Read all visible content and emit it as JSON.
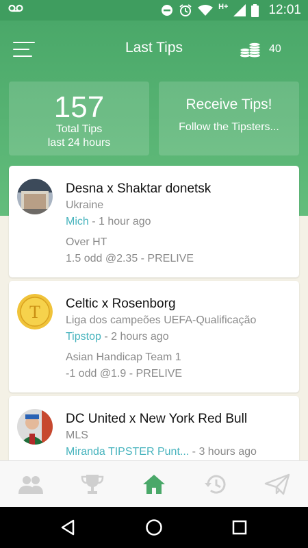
{
  "status_bar": {
    "time": "12:01",
    "network": "H+"
  },
  "header": {
    "title": "Last Tips",
    "coins": "40"
  },
  "stats": {
    "total_count": "157",
    "total_label": "Total Tips",
    "period_label": "last 24 hours",
    "receive_title": "Receive Tips!",
    "receive_subtitle": "Follow the Tipsters..."
  },
  "tips": [
    {
      "match": "Desna x Shaktar donetsk",
      "league": "Ukraine",
      "tipster": "Mich",
      "time": " - 1 hour ago",
      "bet": "Over HT",
      "odds": "1.5 odd @2.35 - PRELIVE",
      "avatar_icon": "tipster-photo"
    },
    {
      "match": "Celtic x Rosenborg",
      "league": "Liga dos campeões UEFA-Qualificação",
      "tipster": "Tipstop",
      "time": " - 2 hours ago",
      "bet": "Asian Handicap Team 1",
      "odds": "-1 odd @1.9 - PRELIVE",
      "avatar_icon": "gold-coin-t-logo"
    },
    {
      "match": "DC United x New York Red Bull",
      "league": "MLS",
      "tipster": "Miranda TIPSTER Punt...",
      "time": " - 3 hours ago",
      "avatar_icon": "tipster-photo"
    }
  ],
  "nav": [
    {
      "name": "tipsters",
      "icon": "people-icon"
    },
    {
      "name": "ranking",
      "icon": "trophy-icon"
    },
    {
      "name": "home",
      "icon": "home-icon",
      "active": true
    },
    {
      "name": "history",
      "icon": "history-icon"
    },
    {
      "name": "send",
      "icon": "send-icon"
    }
  ],
  "colors": {
    "primary": "#4aa869",
    "accent_link": "#46b3bd",
    "inactive_icon": "#cfcfcf",
    "background": "#f4f1e6"
  }
}
